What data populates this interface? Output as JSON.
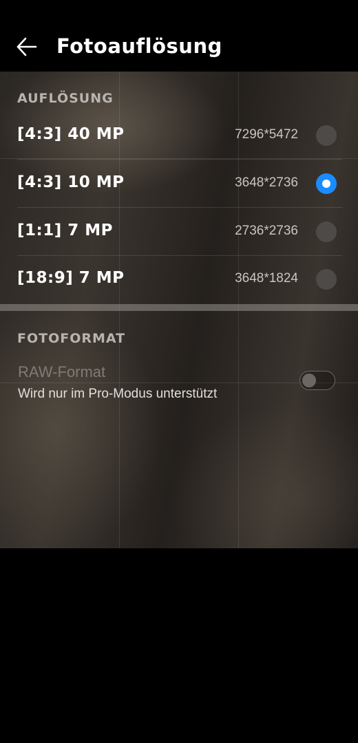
{
  "header": {
    "title": "Fotoauflösung",
    "back_icon": "arrow-left-icon"
  },
  "resolution_section": {
    "label": "AUFLÖSUNG",
    "options": [
      {
        "label": "[4:3] 40 MP",
        "resolution": "7296*5472",
        "selected": false
      },
      {
        "label": "[4:3] 10 MP",
        "resolution": "3648*2736",
        "selected": true
      },
      {
        "label": "[1:1] 7 MP",
        "resolution": "2736*2736",
        "selected": false
      },
      {
        "label": "[18:9] 7 MP",
        "resolution": "3648*1824",
        "selected": false
      }
    ]
  },
  "format_section": {
    "label": "FOTOFORMAT",
    "raw": {
      "title": "RAW-Format",
      "subtitle": "Wird nur im Pro-Modus unterstützt",
      "enabled": false
    }
  },
  "colors": {
    "accent": "#1a8cff",
    "background": "#000000"
  }
}
